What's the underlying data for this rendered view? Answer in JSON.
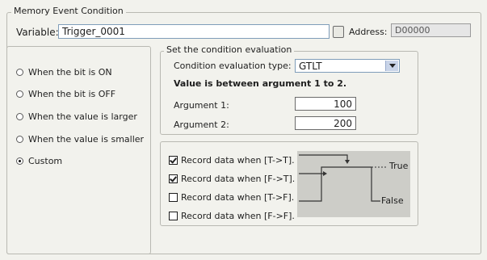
{
  "memory_event": {
    "title": "Memory Event Condition",
    "variable_label": "Variable:",
    "variable_value": "Trigger_0001",
    "address_label": "Address:",
    "address_value": "D00000"
  },
  "conditions": {
    "selected": "Custom",
    "options": [
      "When the bit is ON",
      "When the bit is OFF",
      "When the value is larger",
      "When the value is smaller",
      "Custom"
    ]
  },
  "evaluation": {
    "title": "Set the condition evaluation",
    "type_label": "Condition evaluation type:",
    "type_value": "GTLT",
    "description": "Value is between argument 1 to 2.",
    "arg1_label": "Argument 1:",
    "arg1_value": "100",
    "arg2_label": "Argument 2:",
    "arg2_value": "200"
  },
  "record": {
    "options": [
      {
        "label": "Record data when [T->T].",
        "checked": true
      },
      {
        "label": "Record data when [F->T].",
        "checked": true
      },
      {
        "label": "Record data when [T->F].",
        "checked": false
      },
      {
        "label": "Record data when [F->F].",
        "checked": false
      }
    ],
    "diagram": {
      "true_label": "True",
      "false_label": "False"
    }
  }
}
